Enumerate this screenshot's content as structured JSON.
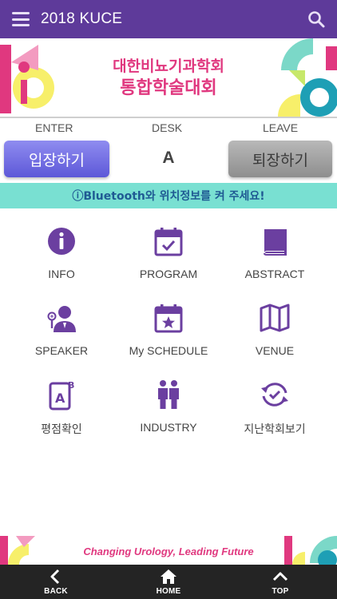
{
  "header": {
    "title": "2018 KUCE",
    "menu_icon": "menu-icon",
    "search_icon": "search-icon"
  },
  "banner": {
    "line1": "대한비뇨기과학회",
    "line2": "통합학술대회"
  },
  "attendance": {
    "enter_label": "ENTER",
    "desk_label": "DESK",
    "leave_label": "LEAVE",
    "enter_button": "입장하기",
    "desk_value": "A",
    "leave_button": "퇴장하기"
  },
  "notice": "ⓘBluetooth와 위치정보를 켜 주세요!",
  "menu": [
    {
      "label": "INFO",
      "icon": "info-icon"
    },
    {
      "label": "PROGRAM",
      "icon": "calendar-check-icon"
    },
    {
      "label": "ABSTRACT",
      "icon": "book-icon"
    },
    {
      "label": "SPEAKER",
      "icon": "speaker-icon"
    },
    {
      "label": "My SCHEDULE",
      "icon": "calendar-star-icon"
    },
    {
      "label": "VENUE",
      "icon": "map-icon"
    },
    {
      "label": "평점확인",
      "icon": "tablet-grade-icon"
    },
    {
      "label": "INDUSTRY",
      "icon": "people-icon"
    },
    {
      "label": "지난학회보기",
      "icon": "history-icon"
    }
  ],
  "footer": {
    "slogan": "Changing Urology, Leading Future"
  },
  "nav": {
    "back": "BACK",
    "home": "HOME",
    "top": "TOP"
  },
  "colors": {
    "header": "#5e3a9a",
    "accent_purple": "#6b3fa0",
    "banner_pink": "#e0387f",
    "enter_button": "#6e69e0",
    "leave_button": "#9e9e9e",
    "notice_bg": "#79e0d2",
    "notice_text": "#1f5a93",
    "nav_bg": "#242424"
  }
}
